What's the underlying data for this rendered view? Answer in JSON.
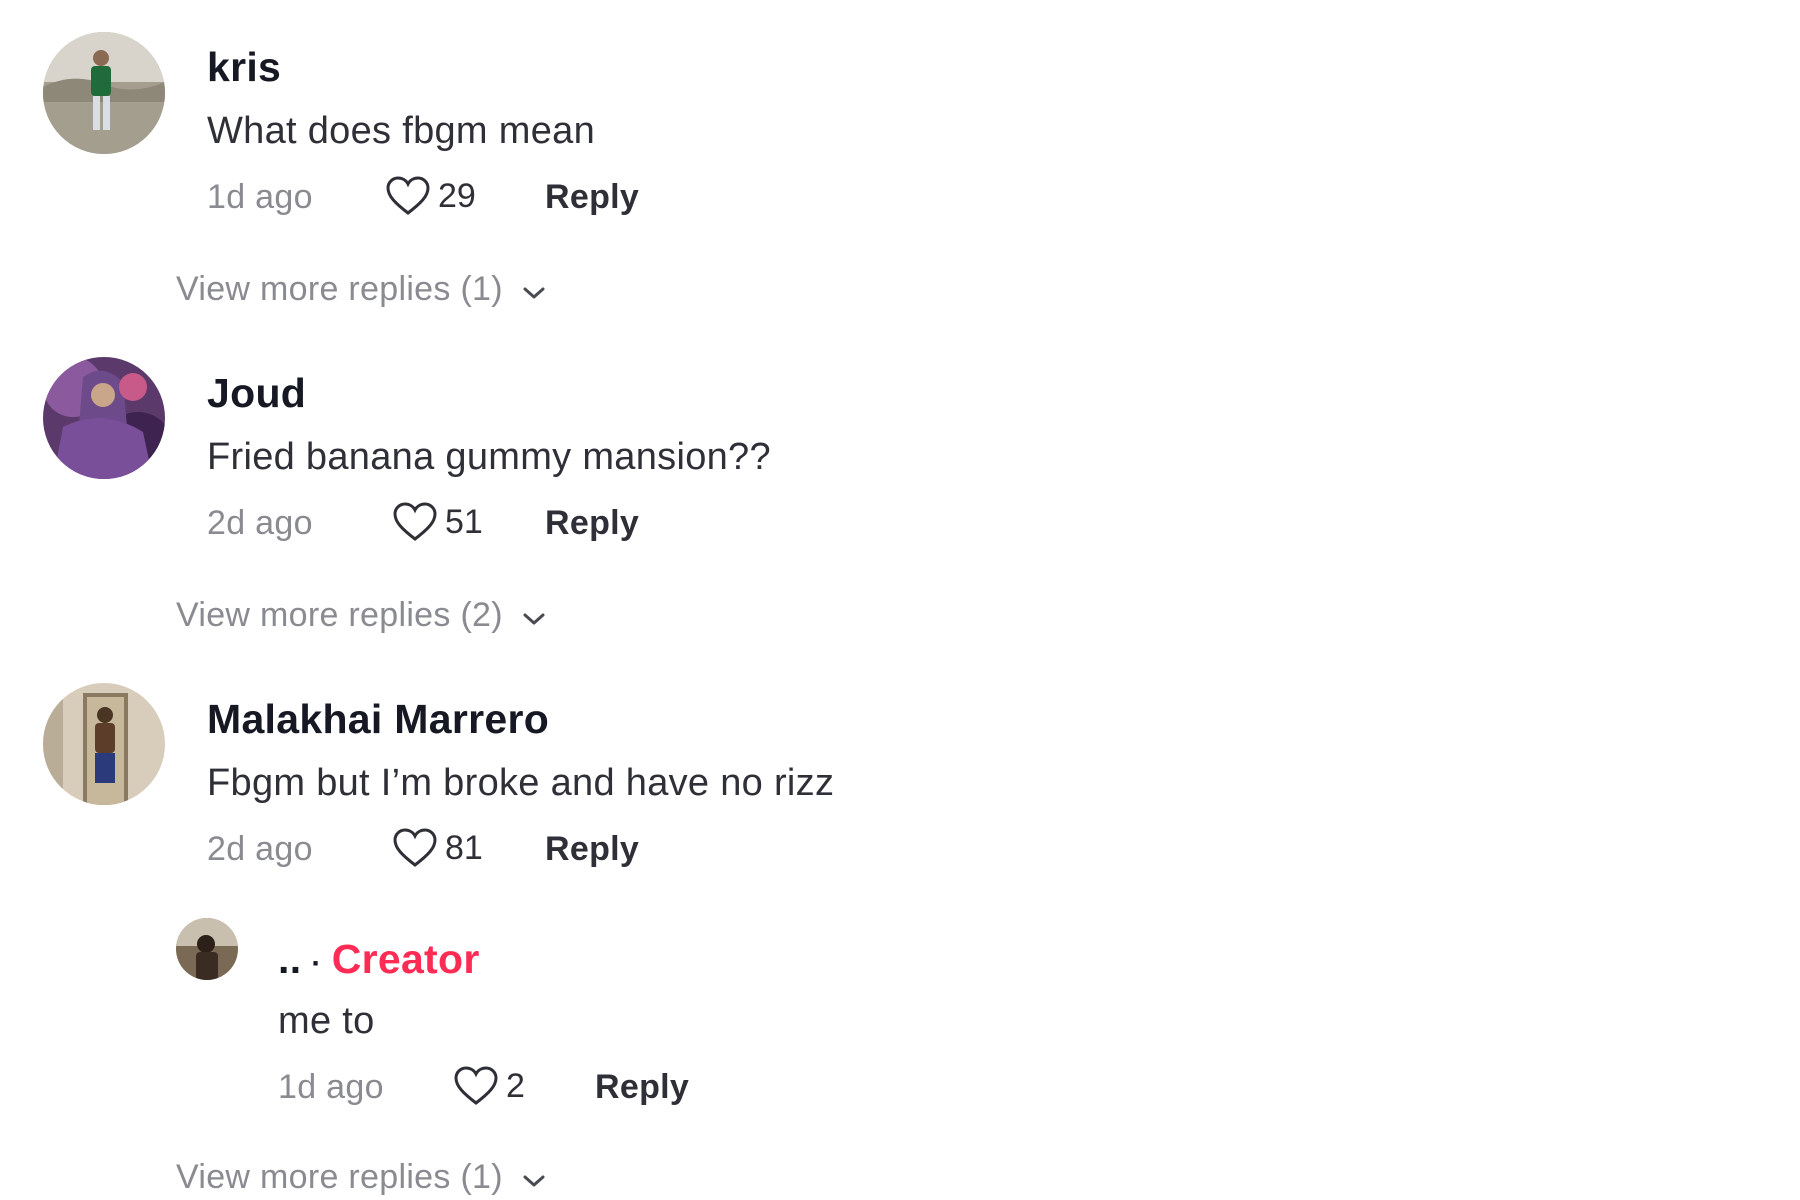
{
  "comments": [
    {
      "username": "kris",
      "text": "What does fbgm mean",
      "time": "1d ago",
      "likes": "29",
      "reply_label": "Reply",
      "view_more": "View more replies (1)",
      "avatar_icon": "user-avatar-photo"
    },
    {
      "username": "Joud",
      "text": "Fried banana gummy mansion??",
      "time": "2d ago",
      "likes": "51",
      "reply_label": "Reply",
      "view_more": "View more replies (2)",
      "avatar_icon": "user-avatar-photo"
    },
    {
      "username": "Malakhai Marrero",
      "text": "Fbgm but I’m broke and have no rizz",
      "time": "2d ago",
      "likes": "81",
      "reply_label": "Reply",
      "avatar_icon": "user-avatar-photo",
      "reply": {
        "username": "..",
        "separator": "·",
        "badge": "Creator",
        "text": "me to",
        "time": "1d ago",
        "likes": "2",
        "reply_label": "Reply",
        "avatar_icon": "user-avatar-photo"
      },
      "view_more": "View more replies (1)"
    }
  ],
  "colors": {
    "creator_badge": "#fe2c55",
    "muted_text": "#8a8b91",
    "primary_text": "#161823"
  }
}
